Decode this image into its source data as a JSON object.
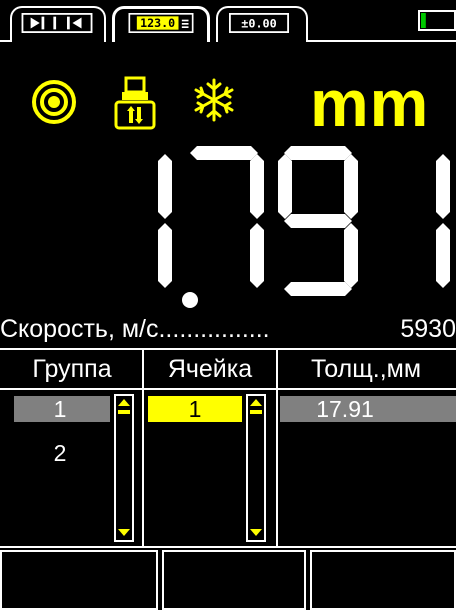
{
  "header": {
    "tabs": [
      {
        "name": "split-mode-icon"
      },
      {
        "name": "numeric-mode-icon",
        "label": "123.0",
        "active": true
      },
      {
        "name": "zero-mode-icon",
        "label": "±0.00"
      }
    ],
    "battery": {
      "level": 0.15
    }
  },
  "status": {
    "unit": "mm",
    "icons": [
      "target-icon",
      "probe-icon",
      "snowflake-icon"
    ]
  },
  "reading": {
    "digits": [
      "1",
      "7",
      "9",
      "1"
    ],
    "decimal_after": 1,
    "value": "17.91"
  },
  "speed": {
    "label": "Скорость, м/с",
    "dots": "................",
    "value": "5930"
  },
  "table": {
    "headers": [
      "Группа",
      "Ячейка",
      "Толщ.,мм"
    ],
    "groups": [
      "1",
      "2"
    ],
    "cell": "1",
    "thickness": "17.91"
  },
  "colors": {
    "accent": "#ffff00",
    "battery": "#00c800",
    "selected_row": "#808080"
  }
}
